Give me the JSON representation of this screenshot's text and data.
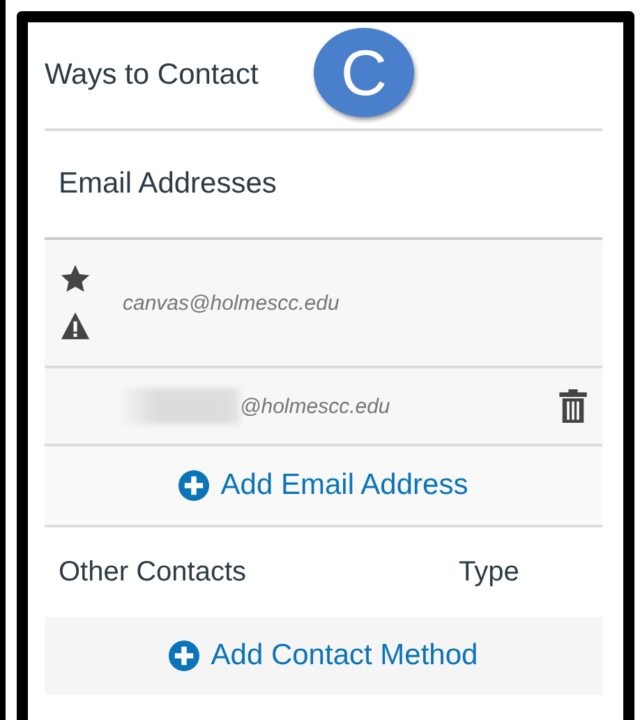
{
  "panel": {
    "title": "Ways to Contact",
    "step_badge": "C"
  },
  "email_section": {
    "heading": "Email Addresses",
    "emails": [
      {
        "address": "canvas@holmescc.edu",
        "starred": true,
        "warning": true,
        "redacted": false,
        "deletable": false
      },
      {
        "address": "@holmescc.edu",
        "starred": false,
        "warning": false,
        "redacted": true,
        "deletable": true
      }
    ],
    "add_button": "Add Email Address"
  },
  "other_section": {
    "columns": [
      "Other Contacts",
      "Type"
    ],
    "add_button": "Add Contact Method"
  }
}
